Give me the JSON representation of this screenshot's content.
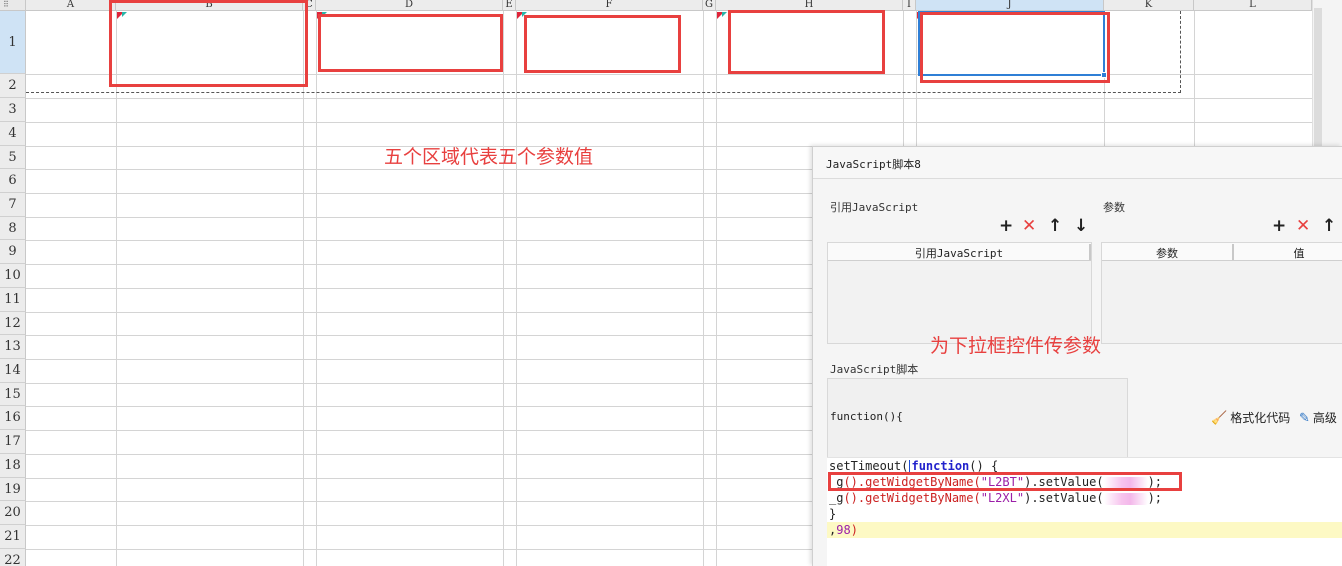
{
  "sheet": {
    "corner_glyph": "⠿",
    "columns": [
      "A",
      "B",
      "C",
      "D",
      "E",
      "F",
      "G",
      "H",
      "I",
      "J",
      "K",
      "L"
    ],
    "active_column": "J",
    "rows": [
      "1",
      "2",
      "3",
      "4",
      "5",
      "6",
      "7",
      "8",
      "9",
      "10",
      "11",
      "12",
      "13",
      "14",
      "15",
      "16",
      "17",
      "18",
      "19",
      "20",
      "21",
      "22"
    ],
    "active_row": "1",
    "annotation_top": "五个区域代表五个参数值",
    "colors": {
      "annotation": "#e8403f",
      "selection": "#2f7fd6",
      "header_active": "#cfe3f5"
    }
  },
  "dialog": {
    "title": "JavaScript脚本8",
    "ref_section_label": "引用JavaScript",
    "params_section_label": "参数",
    "toolbar_icons": {
      "add": "+",
      "delete": "✕",
      "up": "↑",
      "down": "↓"
    },
    "ref_table": {
      "headers": [
        "引用JavaScript"
      ]
    },
    "params_table": {
      "headers": [
        "参数",
        "值"
      ]
    },
    "annotation_mid": "为下拉框控件传参数",
    "script_label": "JavaScript脚本",
    "function_header": "function(){",
    "actions": {
      "format_code": "格式化代码",
      "format_icon": "broom-icon",
      "advanced": "高级",
      "advanced_icon": "edit-icon"
    },
    "code": {
      "line1_pre": "setTimeout(",
      "line1_kw": "function",
      "line1_post": "() {",
      "line2_pre": "_g",
      "line2_mid1": "().getWidgetByName(",
      "line2_str1": "\"L2BT\"",
      "line2_mid2": ").setValue(",
      "line2_tail": ");",
      "line3_pre": "_g",
      "line3_mid1": "().getWidgetByName(",
      "line3_str1": "\"L2XL\"",
      "line3_mid2": ").setValue(",
      "line3_tail": ");",
      "line4": "}",
      "line5_comma": ",",
      "line5_num": "98",
      "line5_paren": ")"
    }
  }
}
